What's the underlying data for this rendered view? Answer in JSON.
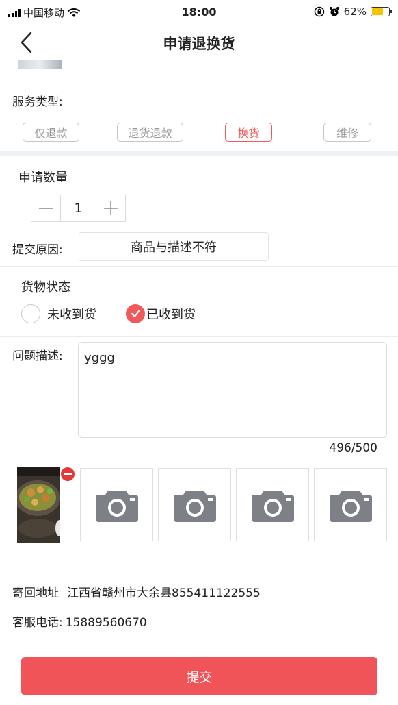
{
  "status_bar": {
    "carrier": "中国移动",
    "time": "18:00",
    "battery_percent": "62%",
    "battery_level": 0.62
  },
  "nav": {
    "title": "申请退换货",
    "back_icon": "chevron-left-icon"
  },
  "service_type": {
    "label": "服务类型:",
    "options": [
      "仅退款",
      "退货退款",
      "换货",
      "维修"
    ],
    "selected": "换货",
    "accent_color": "#f05a5a"
  },
  "quantity": {
    "label": "申请数量",
    "value": "1"
  },
  "reason": {
    "label": "提交原因:",
    "value": "商品与描述不符"
  },
  "goods_status": {
    "label": "货物状态",
    "options": [
      "未收到货",
      "已收到货"
    ],
    "selected": "已收到货"
  },
  "description": {
    "label": "问题描述:",
    "value": "yggg",
    "counter": "496/500"
  },
  "photos": {
    "camera_icon": "camera-icon",
    "remove_icon": "minus-circle-icon"
  },
  "return_address": {
    "label": "寄回地址",
    "value": "江西省赣州市大余县855411122555"
  },
  "service_phone": {
    "label": "客服电话:",
    "value": "15889560670"
  },
  "submit_label": "提交",
  "colors": {
    "primary": "#f05458",
    "divider": "#d8d8d8",
    "band": "#eef1f4"
  }
}
